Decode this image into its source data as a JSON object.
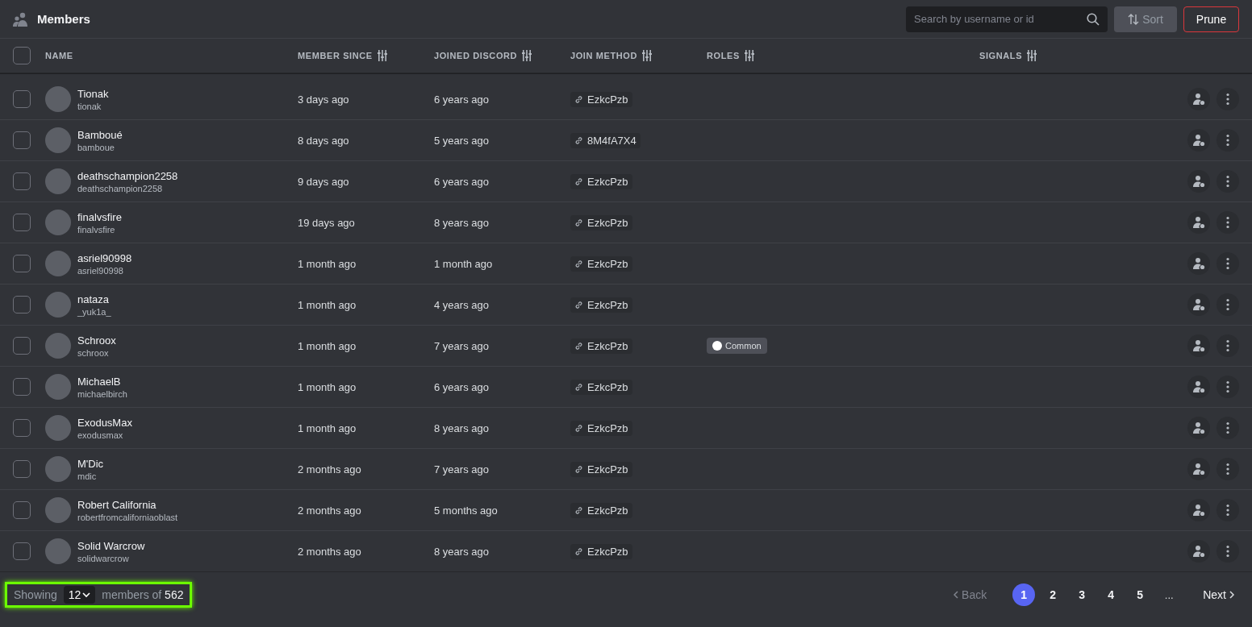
{
  "header": {
    "title": "Members",
    "search": {
      "placeholder": "Search by username or id"
    },
    "sort_button": "Sort",
    "prune_button": "Prune"
  },
  "table": {
    "select_all_checked": false,
    "columns": [
      {
        "label": "NAME",
        "filter": false
      },
      {
        "label": "MEMBER SINCE",
        "filter": true
      },
      {
        "label": "JOINED DISCORD",
        "filter": true
      },
      {
        "label": "JOIN METHOD",
        "filter": true
      },
      {
        "label": "ROLES",
        "filter": true
      },
      {
        "label": "SIGNALS",
        "filter": true
      }
    ],
    "rows": [
      {
        "checked": false,
        "display_name": "Tionak",
        "username": "tionak",
        "member_since": "3 days ago",
        "joined_discord": "6 years ago",
        "join_method": "EzkcPzb",
        "roles": []
      },
      {
        "checked": false,
        "display_name": "Bamboué",
        "username": "bamboue",
        "member_since": "8 days ago",
        "joined_discord": "5 years ago",
        "join_method": "8M4fA7X4",
        "roles": []
      },
      {
        "checked": false,
        "display_name": "deathschampion2258",
        "username": "deathschampion2258",
        "member_since": "9 days ago",
        "joined_discord": "6 years ago",
        "join_method": "EzkcPzb",
        "roles": []
      },
      {
        "checked": false,
        "display_name": "finalvsfire",
        "username": "finalvsfire",
        "member_since": "19 days ago",
        "joined_discord": "8 years ago",
        "join_method": "EzkcPzb",
        "roles": []
      },
      {
        "checked": false,
        "display_name": "asriel90998",
        "username": "asriel90998",
        "member_since": "1 month ago",
        "joined_discord": "1 month ago",
        "join_method": "EzkcPzb",
        "roles": []
      },
      {
        "checked": false,
        "display_name": "nataza",
        "username": "_yuk1a_",
        "member_since": "1 month ago",
        "joined_discord": "4 years ago",
        "join_method": "EzkcPzb",
        "roles": []
      },
      {
        "checked": false,
        "display_name": "Schroox",
        "username": "schroox",
        "member_since": "1 month ago",
        "joined_discord": "7 years ago",
        "join_method": "EzkcPzb",
        "roles": [
          {
            "name": "Common",
            "color": "#ffffff"
          }
        ]
      },
      {
        "checked": false,
        "display_name": "MichaelB",
        "username": "michaelbirch",
        "member_since": "1 month ago",
        "joined_discord": "6 years ago",
        "join_method": "EzkcPzb",
        "roles": []
      },
      {
        "checked": false,
        "display_name": "ExodusMax",
        "username": "exodusmax",
        "member_since": "1 month ago",
        "joined_discord": "8 years ago",
        "join_method": "EzkcPzb",
        "roles": []
      },
      {
        "checked": false,
        "display_name": "M'Dic",
        "username": "mdic",
        "member_since": "2 months ago",
        "joined_discord": "7 years ago",
        "join_method": "EzkcPzb",
        "roles": []
      },
      {
        "checked": false,
        "display_name": "Robert California",
        "username": "robertfromcaliforniaoblast",
        "member_since": "2 months ago",
        "joined_discord": "5 months ago",
        "join_method": "EzkcPzb",
        "roles": []
      },
      {
        "checked": false,
        "display_name": "Solid Warcrow",
        "username": "solidwarcrow",
        "member_since": "2 months ago",
        "joined_discord": "8 years ago",
        "join_method": "EzkcPzb",
        "roles": []
      }
    ]
  },
  "footer": {
    "showing_label": "Showing",
    "page_size": "12",
    "total_label": "members of",
    "total": "562",
    "pagination": {
      "back": "Back",
      "next": "Next",
      "pages": [
        {
          "label": "1",
          "selected": true
        },
        {
          "label": "2",
          "selected": false
        },
        {
          "label": "3",
          "selected": false
        },
        {
          "label": "4",
          "selected": false
        },
        {
          "label": "5",
          "selected": false
        }
      ],
      "ellipsis": "..."
    }
  }
}
